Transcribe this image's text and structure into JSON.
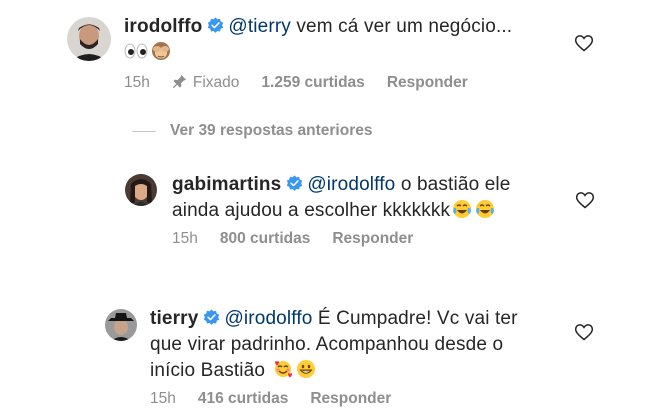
{
  "comments": [
    {
      "username": "irodolffo",
      "mention": "@tierry",
      "text": " vem cá ver um negócio...",
      "emojis": [
        "eyes-emoji",
        "see-no-evil-monkey-emoji"
      ],
      "time": "15h",
      "pinned": "Fixado",
      "likes": "1.259 curtidas",
      "reply": "Responder"
    },
    {
      "username": "gabimartins",
      "mention": "@irodolffo",
      "text": " o bastião ele",
      "text2": "ainda ajudou a escolher kkkkkkk",
      "emojis": [
        "tears-of-joy-emoji",
        "tears-of-joy-emoji"
      ],
      "time": "15h",
      "likes": "800 curtidas",
      "reply": "Responder"
    },
    {
      "username": "tierry",
      "mention": "@irodolffo",
      "text": " É Cumpadre! Vc vai ter",
      "text2": "que virar padrinho. Acompanhou desde o",
      "text3": "início Bastião",
      "emojis": [
        "smiling-face-with-hearts-emoji",
        "grinning-face-emoji"
      ],
      "time": "15h",
      "likes": "416 curtidas",
      "reply": "Responder"
    }
  ],
  "view_replies": "Ver 39 respostas anteriores",
  "colors": {
    "text": "#262626",
    "meta": "#8e8e8e",
    "verified": "#3897f0",
    "mention": "#00376b"
  }
}
